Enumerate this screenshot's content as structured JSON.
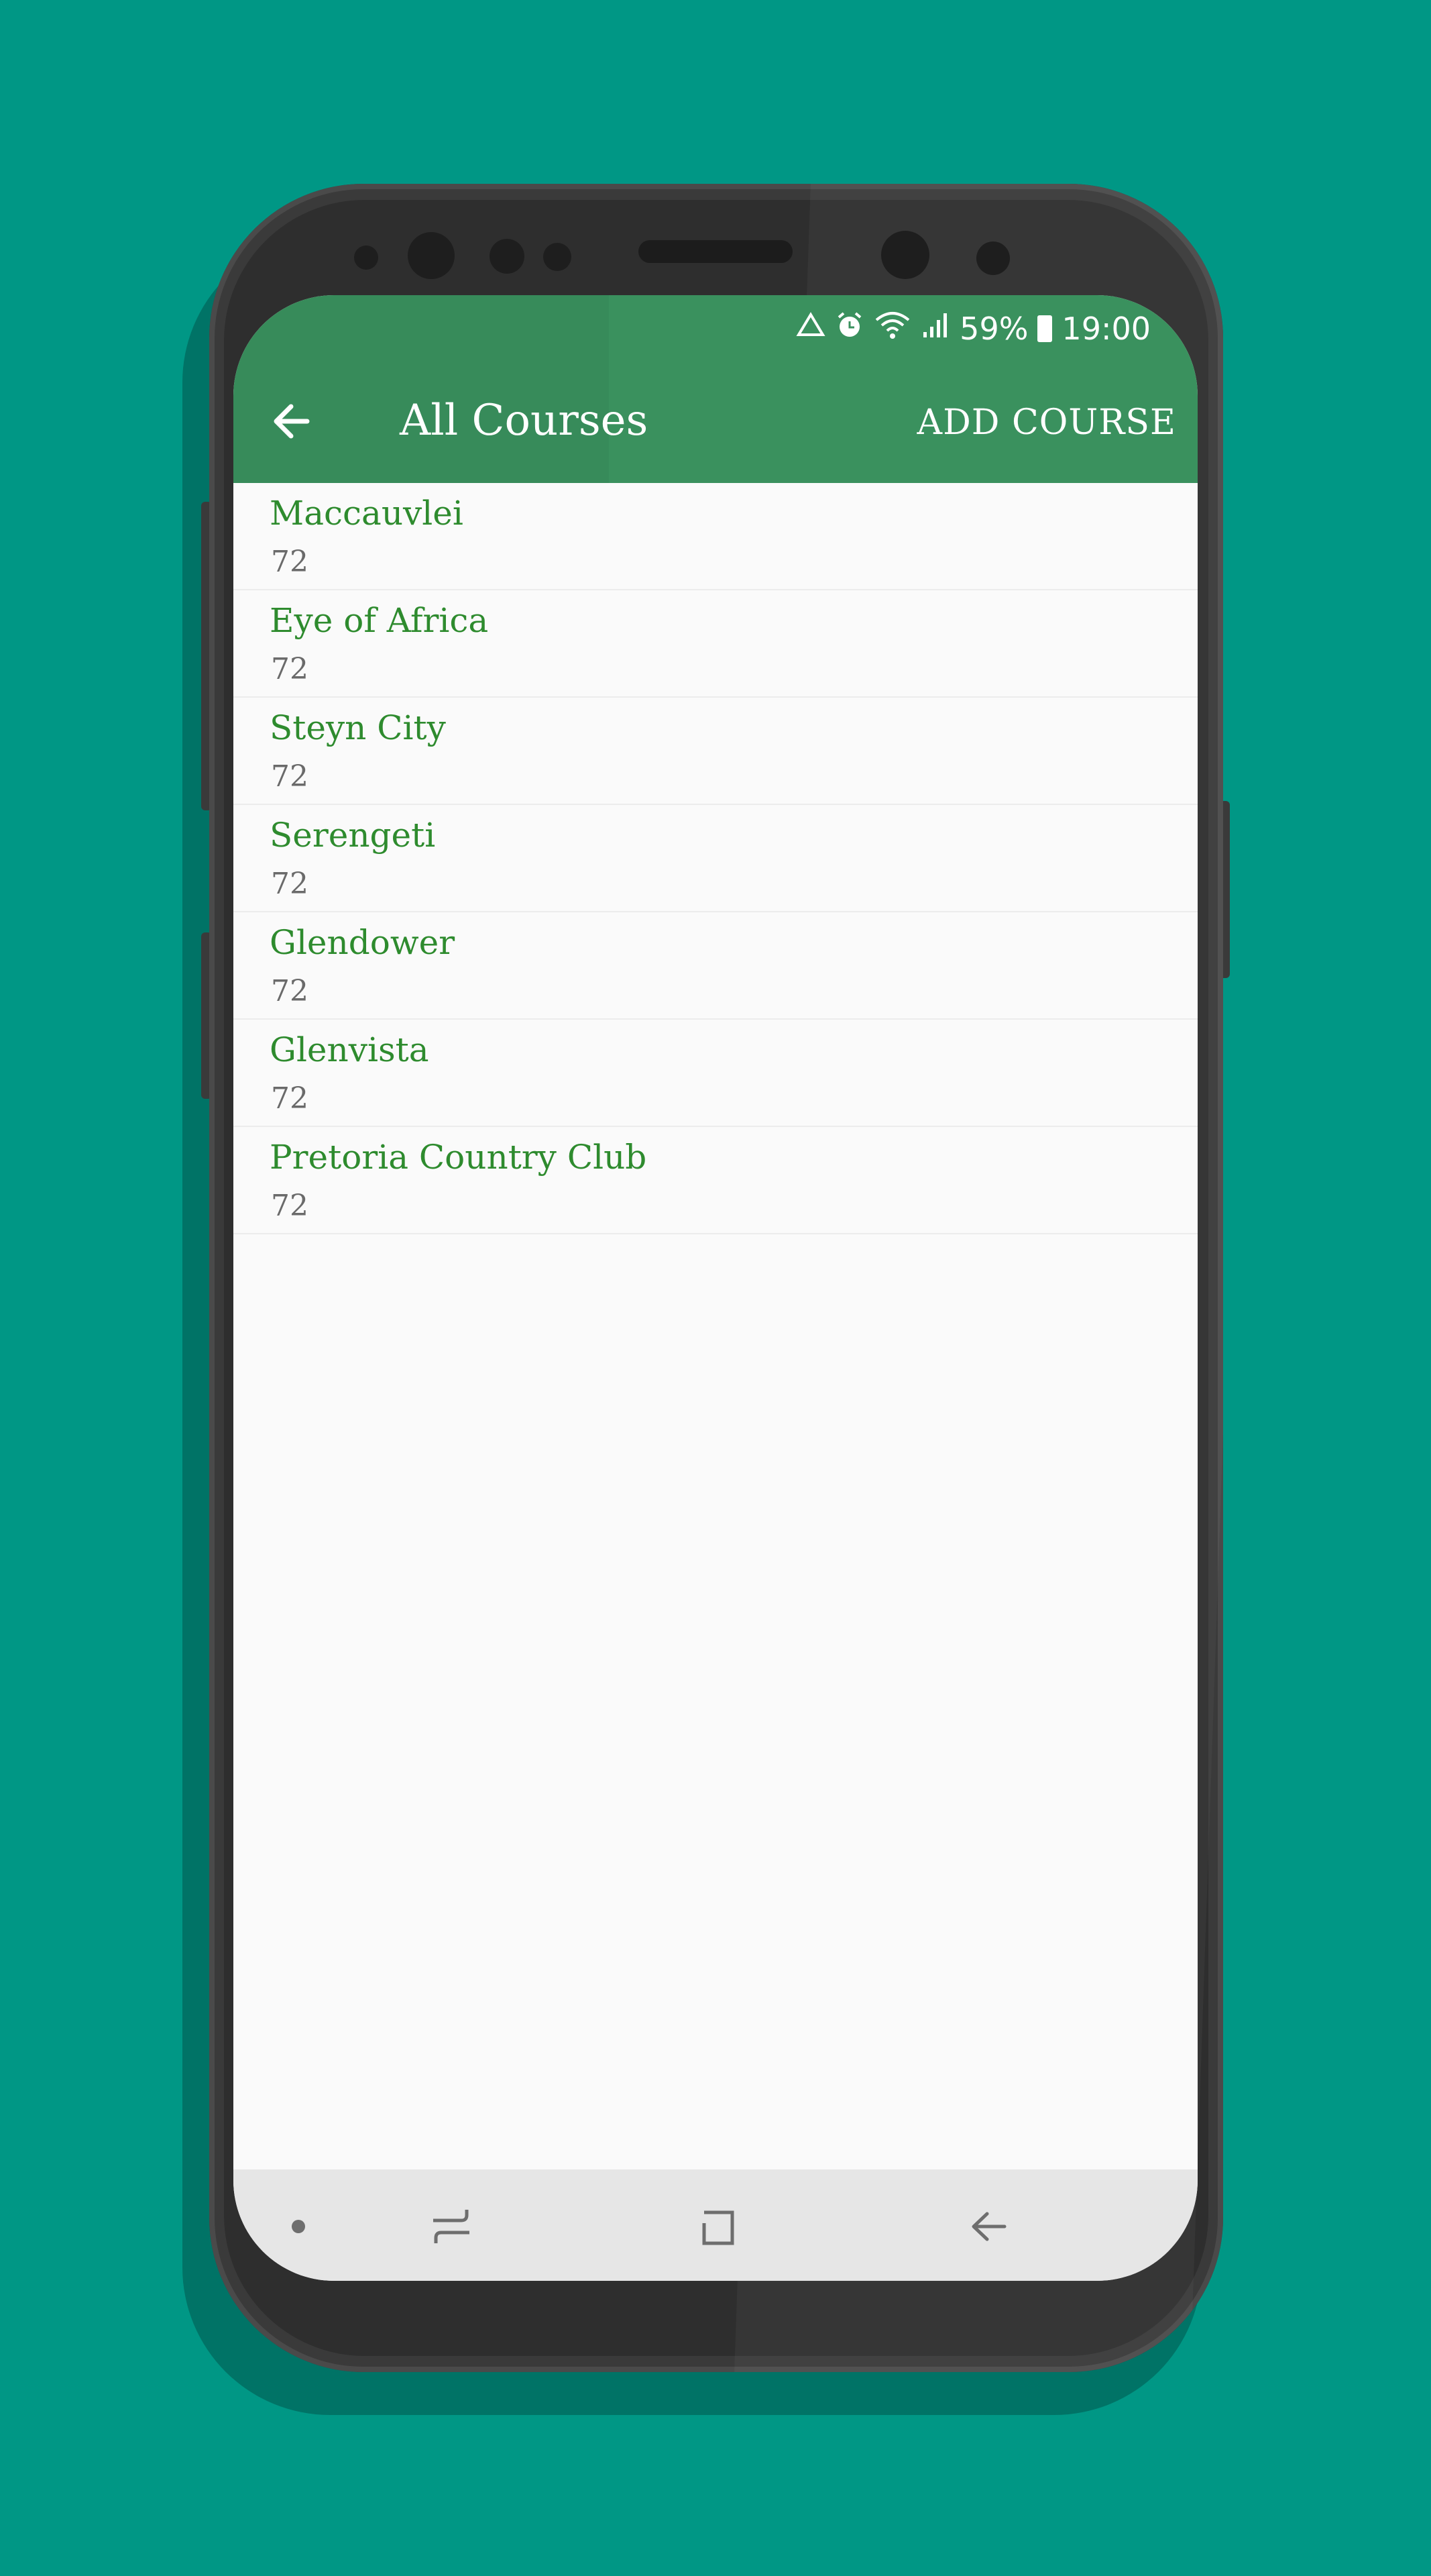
{
  "status_bar": {
    "icons": [
      "recycle-icon",
      "alarm-icon",
      "wifi-icon",
      "signal-icon"
    ],
    "battery_percent": "59%",
    "time": "19:00"
  },
  "app_bar": {
    "back_icon": "arrow-left-icon",
    "title": "All Courses",
    "action_label": "ADD COURSE"
  },
  "courses": [
    {
      "name": "Maccauvlei",
      "par": "72"
    },
    {
      "name": "Eye of Africa",
      "par": "72"
    },
    {
      "name": "Steyn City",
      "par": "72"
    },
    {
      "name": "Serengeti",
      "par": "72"
    },
    {
      "name": "Glendower",
      "par": "72"
    },
    {
      "name": "Glenvista",
      "par": "72"
    },
    {
      "name": "Pretoria Country Club",
      "par": "72"
    }
  ],
  "nav_bar": {
    "items": [
      "dot-icon",
      "recent-apps-icon",
      "home-icon",
      "back-icon"
    ]
  },
  "colors": {
    "background": "#009785",
    "app_bar": "#3a915e",
    "course_name": "#2e8b2e",
    "par_text": "#6a6a6a"
  }
}
